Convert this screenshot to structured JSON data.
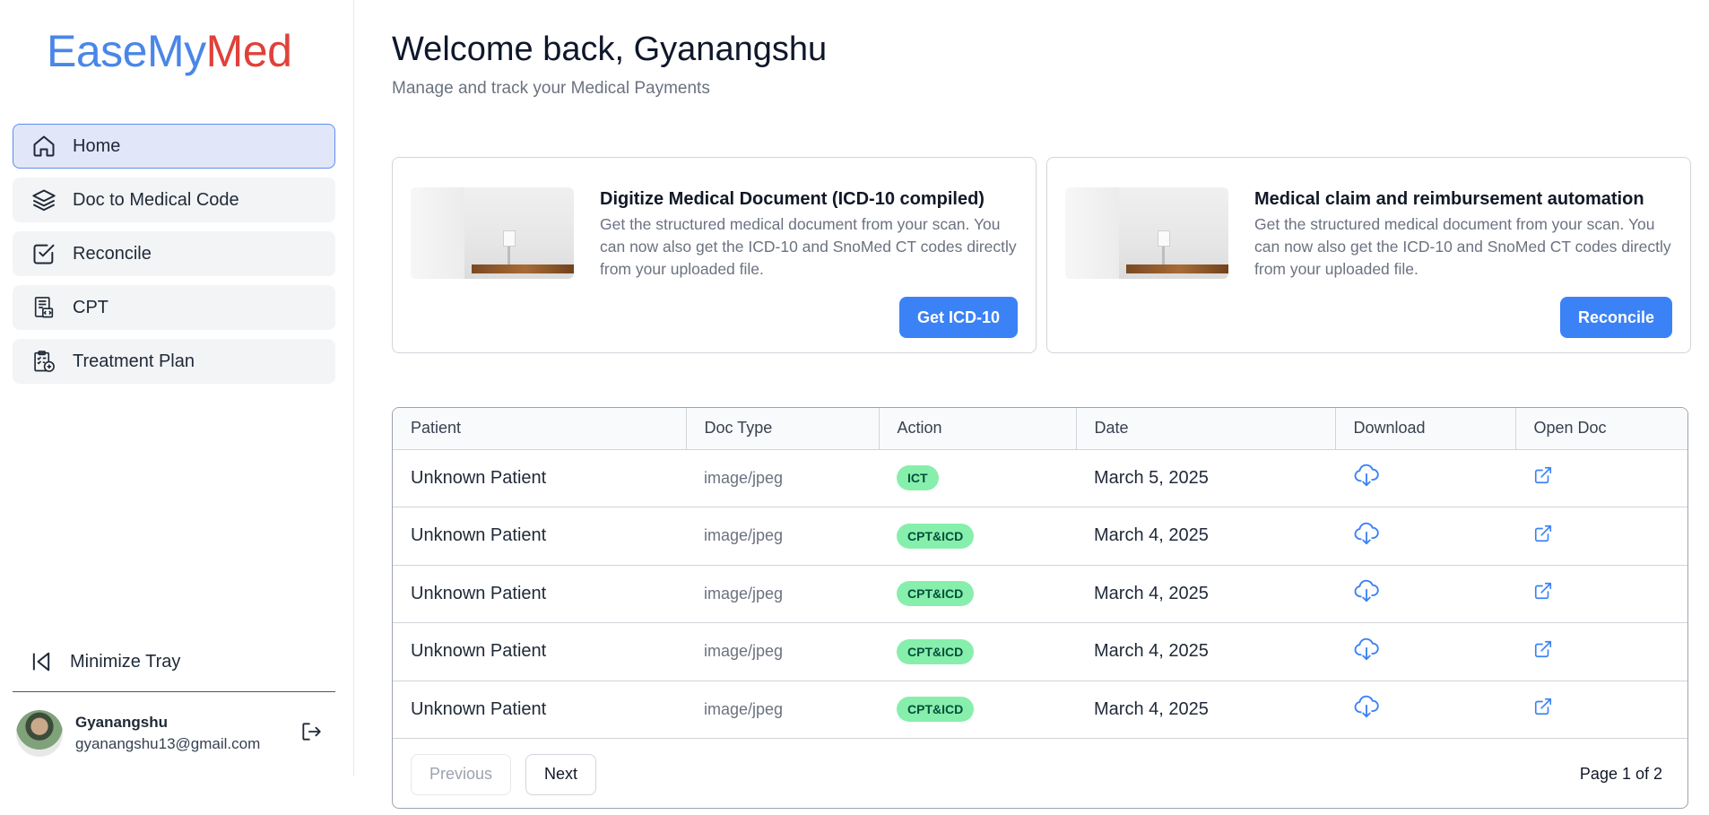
{
  "brand": {
    "part1": "EaseMy",
    "part2": "Med"
  },
  "sidebar": {
    "items": [
      {
        "label": "Home",
        "icon": "home-icon",
        "active": true
      },
      {
        "label": "Doc to Medical Code",
        "icon": "layers-icon",
        "active": false
      },
      {
        "label": "Reconcile",
        "icon": "check-square-icon",
        "active": false
      },
      {
        "label": "CPT",
        "icon": "document-code-icon",
        "active": false
      },
      {
        "label": "Treatment Plan",
        "icon": "clipboard-plan-icon",
        "active": false
      }
    ],
    "minimize_label": "Minimize Tray"
  },
  "user": {
    "name": "Gyanangshu",
    "email": "gyanangshu13@gmail.com"
  },
  "header": {
    "title": "Welcome back, Gyanangshu",
    "subtitle": "Manage and track your Medical Payments"
  },
  "cards": [
    {
      "title": "Digitize Medical Document (ICD-10 compiled)",
      "description": "Get the structured medical document from your scan. You can now also get the ICD-10 and SnoMed CT codes directly from your uploaded file.",
      "button": "Get ICD-10"
    },
    {
      "title": "Medical claim and reimbursement automation",
      "description": "Get the structured medical document from your scan. You can now also get the ICD-10 and SnoMed CT codes directly from your uploaded file.",
      "button": "Reconcile"
    }
  ],
  "table": {
    "columns": [
      "Patient",
      "Doc Type",
      "Action",
      "Date",
      "Download",
      "Open Doc"
    ],
    "rows": [
      {
        "patient": "Unknown Patient",
        "doc_type": "image/jpeg",
        "action": "ICT",
        "date": "March 5, 2025"
      },
      {
        "patient": "Unknown Patient",
        "doc_type": "image/jpeg",
        "action": "CPT&ICD",
        "date": "March 4, 2025"
      },
      {
        "patient": "Unknown Patient",
        "doc_type": "image/jpeg",
        "action": "CPT&ICD",
        "date": "March 4, 2025"
      },
      {
        "patient": "Unknown Patient",
        "doc_type": "image/jpeg",
        "action": "CPT&ICD",
        "date": "March 4, 2025"
      },
      {
        "patient": "Unknown Patient",
        "doc_type": "image/jpeg",
        "action": "CPT&ICD",
        "date": "March 4, 2025"
      }
    ]
  },
  "pagination": {
    "previous": "Previous",
    "next": "Next",
    "page_info": "Page 1 of 2"
  },
  "colors": {
    "primary": "#3b82f6",
    "brand_blue": "#4a86e8",
    "brand_red": "#e0413a",
    "badge_green": "#86efac"
  }
}
